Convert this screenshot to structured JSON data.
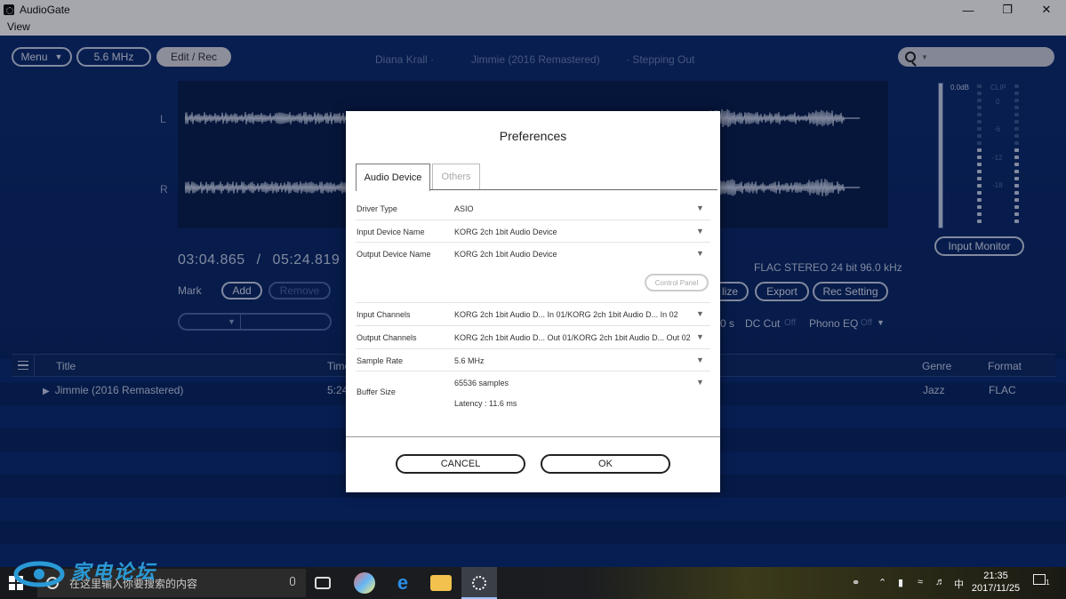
{
  "window": {
    "title": "AudioGate",
    "menu": [
      "View"
    ],
    "controls": [
      "minimize-icon",
      "restore-icon",
      "close-icon"
    ]
  },
  "toolbar": {
    "menu_label": "Menu",
    "rate_label": "5.6 MHz",
    "edit_label": "Edit / Rec",
    "artist": "Diana Krall",
    "track": "Jimmie (2016 Remastered)",
    "album": "Stepping Out",
    "search_placeholder": ""
  },
  "waveform": {
    "left_label": "L",
    "right_label": "R"
  },
  "transport": {
    "position": "03:04.865",
    "separator": "/",
    "duration": "05:24.819",
    "mark_label": "Mark",
    "add_label": "Add",
    "remove_label": "Remove",
    "format": "FLAC STEREO 24 bit 96.0 kHz",
    "normalize_label": "lize",
    "export_label": "Export",
    "rec_setting_label": "Rec Setting",
    "fade_suffix": "0 s",
    "dc_cut_label": "DC Cut",
    "dc_cut_value": "Off",
    "phono_eq_label": "Phono EQ",
    "phono_eq_value": "Off"
  },
  "meter": {
    "peak_label": "0.0dB",
    "clip_label": "CLIP",
    "scale": [
      "0",
      "-6",
      "-12",
      "-18"
    ],
    "input_monitor_label": "Input Monitor"
  },
  "tracklist": {
    "columns": {
      "title": "Title",
      "time": "Time",
      "genre": "Genre",
      "format": "Format"
    },
    "rows": [
      {
        "title": "Jimmie (2016 Remastered)",
        "time": "5:24",
        "genre": "Jazz",
        "format": "FLAC"
      }
    ]
  },
  "dialog": {
    "title": "Preferences",
    "tabs": [
      "Audio Device",
      "Others"
    ],
    "rows": [
      {
        "label": "Driver Type",
        "value": "ASIO"
      },
      {
        "label": "Input Device Name",
        "value": "KORG 2ch 1bit Audio Device"
      },
      {
        "label": "Output Device Name",
        "value": "KORG 2ch 1bit Audio Device"
      },
      {
        "label": "Input Channels",
        "value": "KORG 2ch 1bit Audio D... In 01/KORG 2ch 1bit Audio D... In 02"
      },
      {
        "label": "Output Channels",
        "value": "KORG 2ch 1bit Audio D... Out 01/KORG 2ch 1bit Audio D... Out 02"
      },
      {
        "label": "Sample Rate",
        "value": "5.6 MHz"
      },
      {
        "label": "Buffer Size",
        "value": "65536 samples",
        "sub": "Latency : 11.6 ms"
      }
    ],
    "control_panel_label": "Control Panel",
    "cancel_label": "CANCEL",
    "ok_label": "OK"
  },
  "taskbar": {
    "search_placeholder": "在这里输入你要搜索的内容",
    "ime": "中",
    "time": "21:35",
    "date": "2017/11/25",
    "notification_count": "1"
  },
  "watermark": {
    "text": "家电论坛"
  },
  "colors": {
    "app_bg": "#0b2f74",
    "panel_line": "#c8d4ea",
    "dialog_bg": "#ffffff"
  }
}
